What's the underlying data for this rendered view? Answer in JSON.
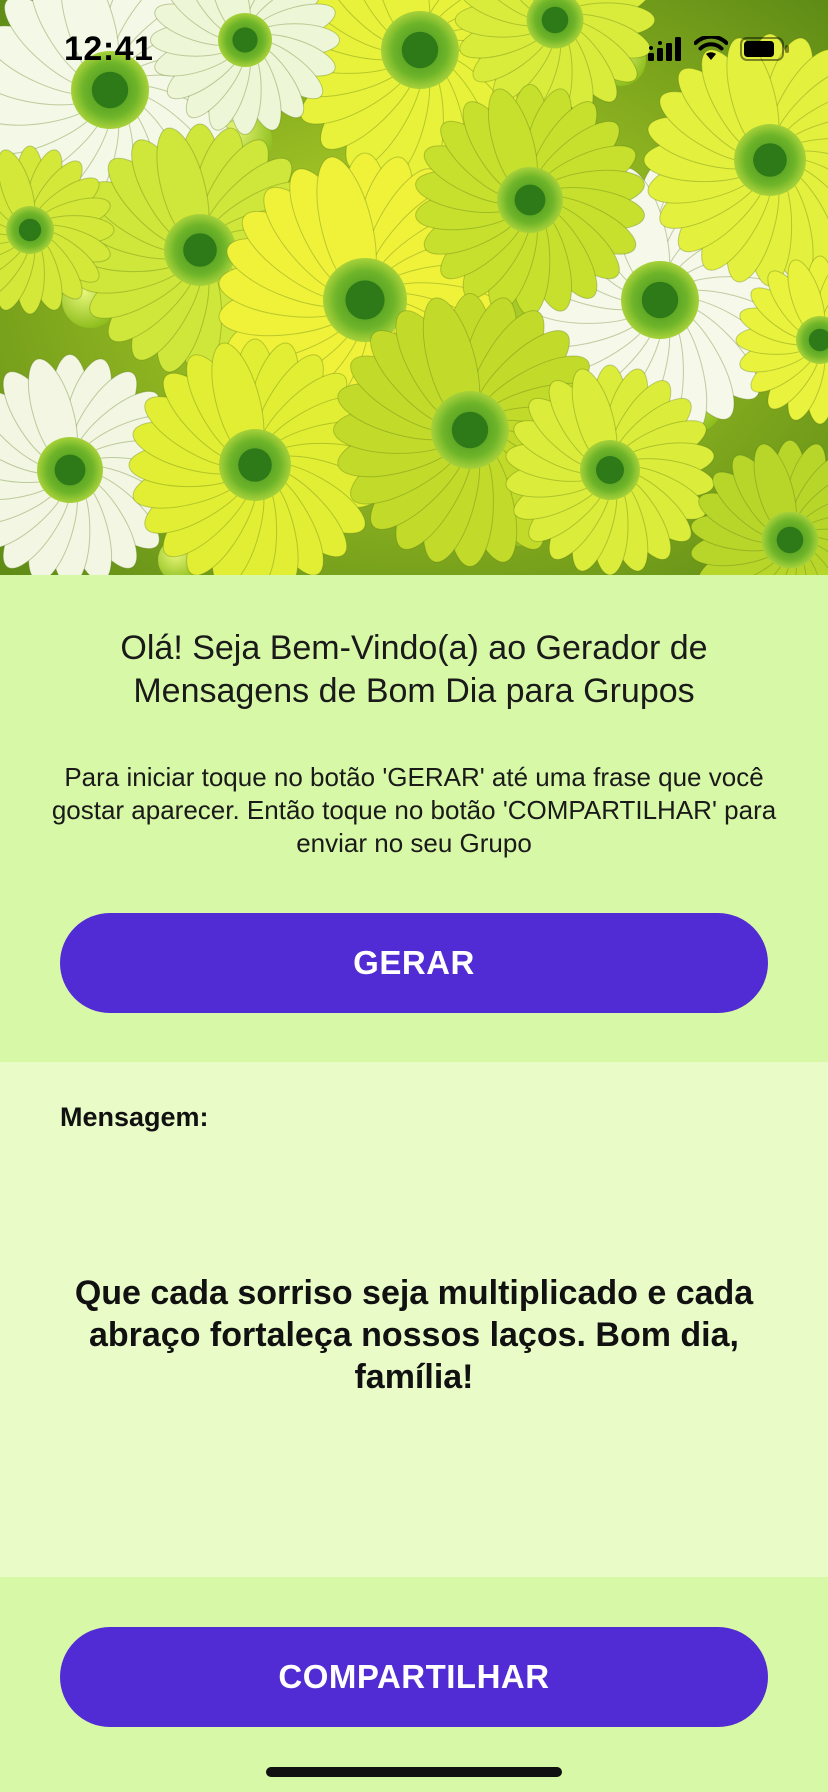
{
  "status_bar": {
    "time": "12:41",
    "icons": [
      "cellular-signal-icon",
      "wifi-icon",
      "battery-icon"
    ]
  },
  "hero": {
    "image": "green-and-yellow-daisy-flowers"
  },
  "intro": {
    "welcome": "Olá! Seja Bem-Vindo(a) ao Gerador de Mensagens de Bom Dia para Grupos",
    "instructions": "Para iniciar toque no botão 'GERAR' até uma frase que você gostar aparecer. Então toque no botão 'COMPARTILHAR' para enviar no seu Grupo",
    "generate_label": "GERAR"
  },
  "message": {
    "label": "Mensagem:",
    "text": "Que cada sorriso seja multiplicado e cada abraço fortaleça nossos laços. Bom dia, família!"
  },
  "share": {
    "label": "COMPARTILHAR"
  },
  "colors": {
    "button": "#512bd4",
    "intro_bg": "#d7f8a6",
    "message_bg": "#e9fcc8"
  }
}
